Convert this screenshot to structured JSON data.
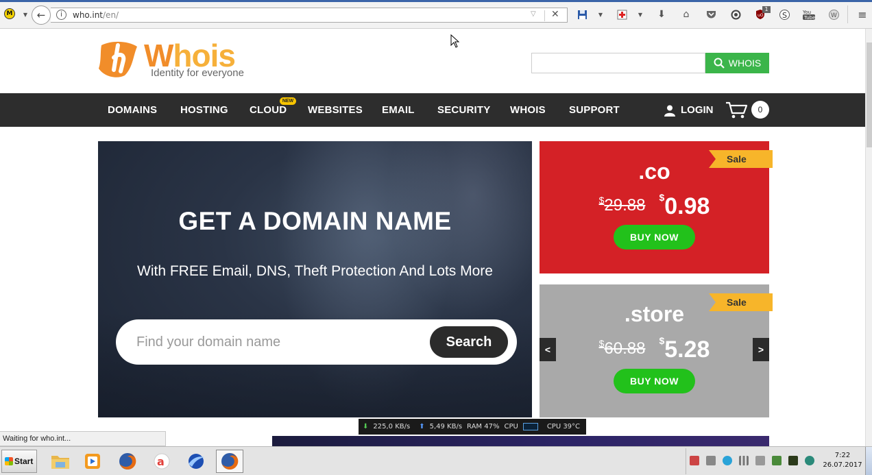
{
  "browser": {
    "url_host": "who.int",
    "url_path": "/en/"
  },
  "header": {
    "logo_first_letter": "W",
    "logo_rest": "hois",
    "tagline": "Identity for everyone",
    "search_value": "",
    "search_button": "WHOIS"
  },
  "nav": {
    "items": [
      "DOMAINS",
      "HOSTING",
      "CLOUD",
      "WEBSITES",
      "EMAIL",
      "SECURITY",
      "WHOIS",
      "SUPPORT"
    ],
    "cloud_badge": "NEW",
    "login": "LOGIN",
    "cart_count": "0"
  },
  "hero": {
    "title": "GET A DOMAIN NAME",
    "subtitle": "With FREE Email, DNS, Theft Protection And Lots More",
    "search_placeholder": "Find your domain name",
    "search_button": "Search"
  },
  "promos": [
    {
      "badge": "Sale",
      "tld": ".co",
      "old_currency": "$",
      "old_price": "29.88",
      "new_currency": "$",
      "new_price": "0.98",
      "button": "BUY NOW",
      "color": "#d42126"
    },
    {
      "badge": "Sale",
      "tld": ".store",
      "old_currency": "$",
      "old_price": "60.88",
      "new_currency": "$",
      "new_price": "5.28",
      "button": "BUY NOW",
      "color": "#a9a9a9"
    }
  ],
  "carousel": {
    "prev": "<",
    "next": ">"
  },
  "status_bar": {
    "text": "Waiting for who.int..."
  },
  "net_monitor": {
    "down": "225,0 KB/s",
    "up": "5,49 KB/s",
    "ram": "RAM 47%",
    "cpu_label": "CPU",
    "cpu_temp": "CPU 39°C"
  },
  "taskbar": {
    "start": "Start",
    "time": "7:22",
    "date": "26.07.2017"
  },
  "colors": {
    "brand_orange": "#f18d2a",
    "brand_yellow": "#f6b03a",
    "nav_bg": "#2d2d2d",
    "green": "#3bb54a",
    "buy_green": "#22c11b",
    "sale_yellow": "#f7b52a"
  }
}
